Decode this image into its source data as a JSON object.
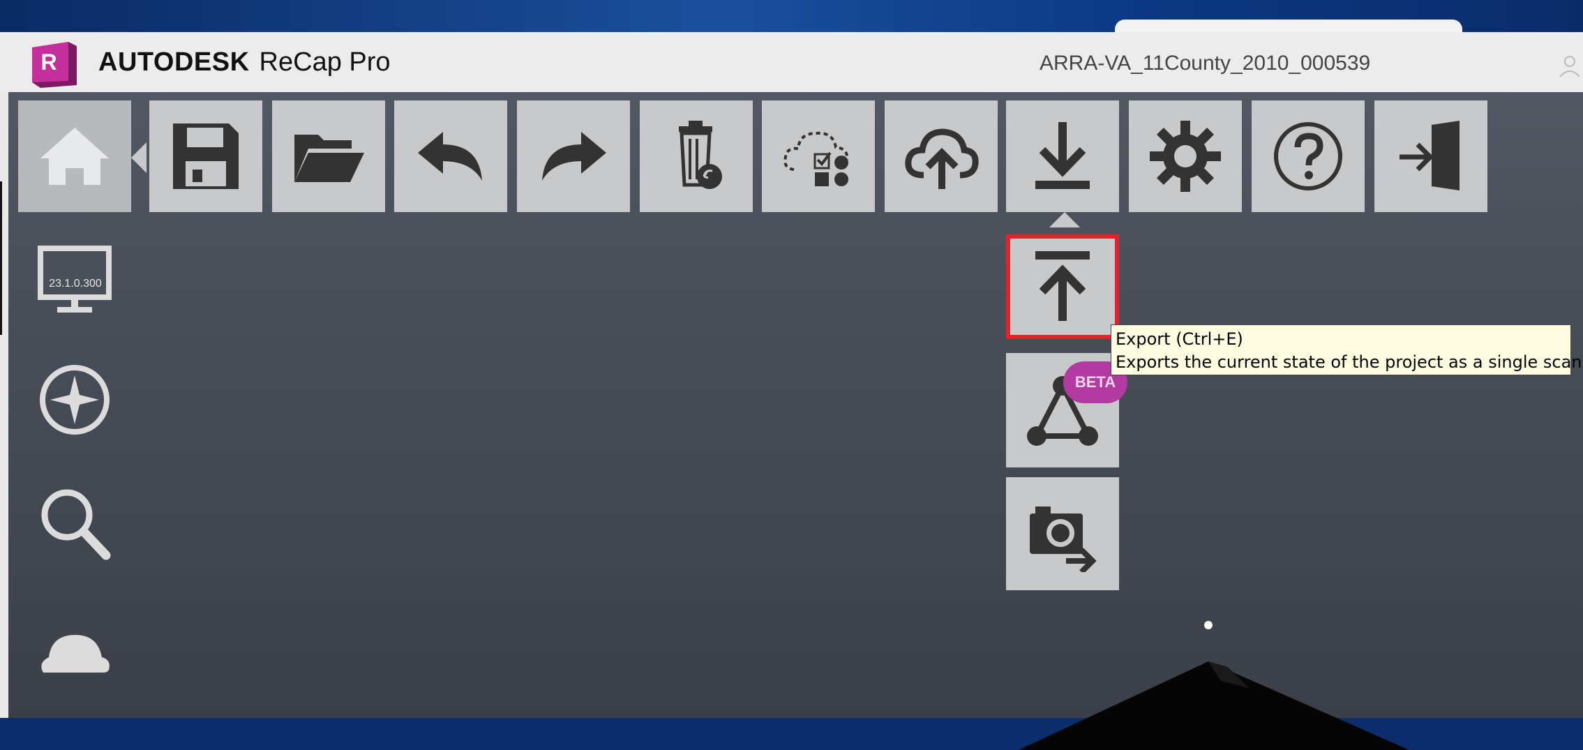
{
  "window": {
    "brand_primary": "AUTODESK",
    "brand_product": "ReCap Pro",
    "logo_letter": "R",
    "project_title": "ARRA-VA_11County_2010_000539"
  },
  "toolbar": {
    "items": [
      {
        "name": "home",
        "icon": "home-icon"
      },
      {
        "name": "save",
        "icon": "floppy-disk-icon"
      },
      {
        "name": "open",
        "icon": "folder-open-icon"
      },
      {
        "name": "undo",
        "icon": "undo-arrow-icon"
      },
      {
        "name": "redo",
        "icon": "redo-arrow-icon"
      },
      {
        "name": "recycle-bin",
        "icon": "trash-restore-icon"
      },
      {
        "name": "cloud-selection",
        "icon": "cloud-region-icon"
      },
      {
        "name": "upload",
        "icon": "cloud-upload-icon"
      },
      {
        "name": "download",
        "icon": "download-icon"
      },
      {
        "name": "settings",
        "icon": "gear-icon"
      },
      {
        "name": "help",
        "icon": "help-icon"
      },
      {
        "name": "exit",
        "icon": "exit-door-icon"
      }
    ]
  },
  "dropdown": {
    "items": [
      {
        "name": "export",
        "icon": "export-upload-icon",
        "highlighted": true
      },
      {
        "name": "mesh",
        "icon": "triangle-network-icon",
        "badge": "BETA"
      },
      {
        "name": "snapshot",
        "icon": "camera-export-icon"
      }
    ]
  },
  "tooltip": {
    "title": "Export (Ctrl+E)",
    "description": "Exports the current state of the project as a single scan."
  },
  "sidebar": {
    "version": "23.1.0.300",
    "items": [
      {
        "name": "display",
        "icon": "monitor-icon"
      },
      {
        "name": "navigation",
        "icon": "compass-icon"
      },
      {
        "name": "search",
        "icon": "search-icon"
      },
      {
        "name": "cloud",
        "icon": "cloud-icon"
      }
    ]
  },
  "colors": {
    "window_bg": "#4a505a",
    "button_bg": "#c8c9cb",
    "icon_dark": "#333333",
    "highlight": "#e0242b",
    "beta_badge": "#b33aa0",
    "tooltip_bg": "#fffde1"
  }
}
